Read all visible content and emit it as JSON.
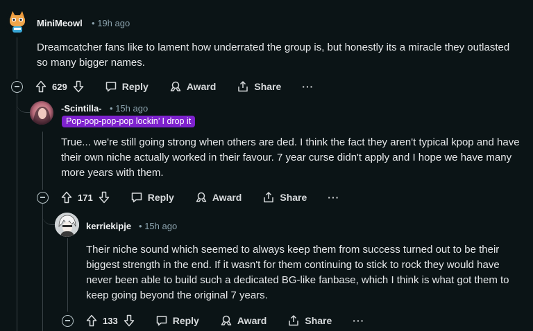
{
  "comments": [
    {
      "username": "MiniMeowl",
      "time": "19h ago",
      "flair": "",
      "body": [
        "Dreamcatcher fans like to lament how underrated the group is, but honestly its a miracle they outlasted so many bigger names."
      ],
      "score": "629",
      "reply_label": "Reply",
      "award_label": "Award",
      "share_label": "Share",
      "more_label": "···"
    },
    {
      "username": "-Scintilla-",
      "time": "15h ago",
      "flair": "Pop-pop-pop-pop lockin’ I drop it",
      "body": [
        "True... we're still going strong when others are ded. I think the fact they aren't typical kpop and have their own niche actually worked in their favour. 7 year curse didn't apply and I hope we have many more years with them."
      ],
      "score": "171",
      "reply_label": "Reply",
      "award_label": "Award",
      "share_label": "Share",
      "more_label": "···"
    },
    {
      "username": "kerriekipje",
      "time": "15h ago",
      "flair": "",
      "body": [
        "Their niche sound which seemed to always keep them from success turned out to be their biggest strength in the end. If it wasn't for them continuing to stick to rock they would have never been able to build such a dedicated BG-like fanbase, which I think is what got them to keep going beyond the original 7 years."
      ],
      "score": "133",
      "reply_label": "Reply",
      "award_label": "Award",
      "share_label": "Share",
      "more_label": "···"
    }
  ],
  "separator": "•",
  "icons": {
    "upvote": "upvote-arrow-icon",
    "downvote": "downvote-arrow-icon",
    "reply": "comment-bubble-icon",
    "award": "award-ribbon-icon",
    "share": "share-upload-icon",
    "collapse": "collapse-minus-icon"
  },
  "colors": {
    "background": "#0b1416",
    "flair": "#7e22ce",
    "meta": "#8ba2ad",
    "thread_line": "#3a4347"
  }
}
